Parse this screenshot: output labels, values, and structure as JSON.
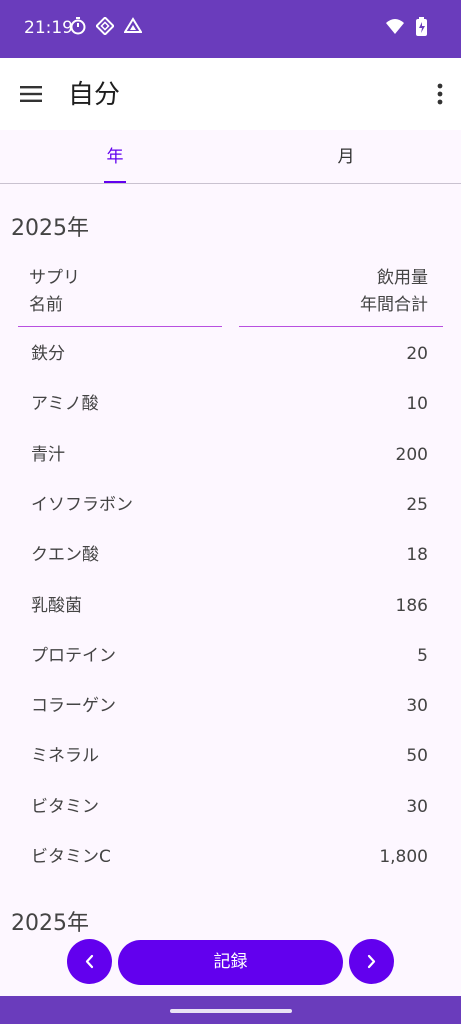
{
  "status_bar": {
    "time": "21:19",
    "left_icons": [
      "timer-icon",
      "diamond-app-icon",
      "drive-icon"
    ],
    "right_icons": [
      "wifi-icon",
      "battery-charging-icon"
    ],
    "color": "#6a3cbc"
  },
  "app_bar": {
    "title": "自分",
    "menu_icon": "hamburger-menu-icon",
    "more_icon": "more-vertical-icon"
  },
  "tabs": [
    {
      "label": "年",
      "selected": true
    },
    {
      "label": "月",
      "selected": false
    }
  ],
  "section": {
    "year_title": "2025年",
    "columns": {
      "left": {
        "line1": "サプリ",
        "line2": "名前"
      },
      "right": {
        "line1": "飲用量",
        "line2": "年間合計"
      }
    },
    "rows": [
      {
        "name": "鉄分",
        "value": "20"
      },
      {
        "name": "アミノ酸",
        "value": "10"
      },
      {
        "name": "青汁",
        "value": "200"
      },
      {
        "name": "イソフラボン",
        "value": "25"
      },
      {
        "name": "クエン酸",
        "value": "18"
      },
      {
        "name": "乳酸菌",
        "value": "186"
      },
      {
        "name": "プロテイン",
        "value": "5"
      },
      {
        "name": "コラーゲン",
        "value": "30"
      },
      {
        "name": "ミネラル",
        "value": "50"
      },
      {
        "name": "ビタミン",
        "value": "30"
      },
      {
        "name": "ビタミンC",
        "value": "1,800"
      }
    ]
  },
  "next_section": {
    "year_title": "2025年"
  },
  "bottom_bar": {
    "prev_icon": "chevron-left-icon",
    "record_label": "記録",
    "next_icon": "chevron-right-icon",
    "accent": "#6200ee"
  }
}
